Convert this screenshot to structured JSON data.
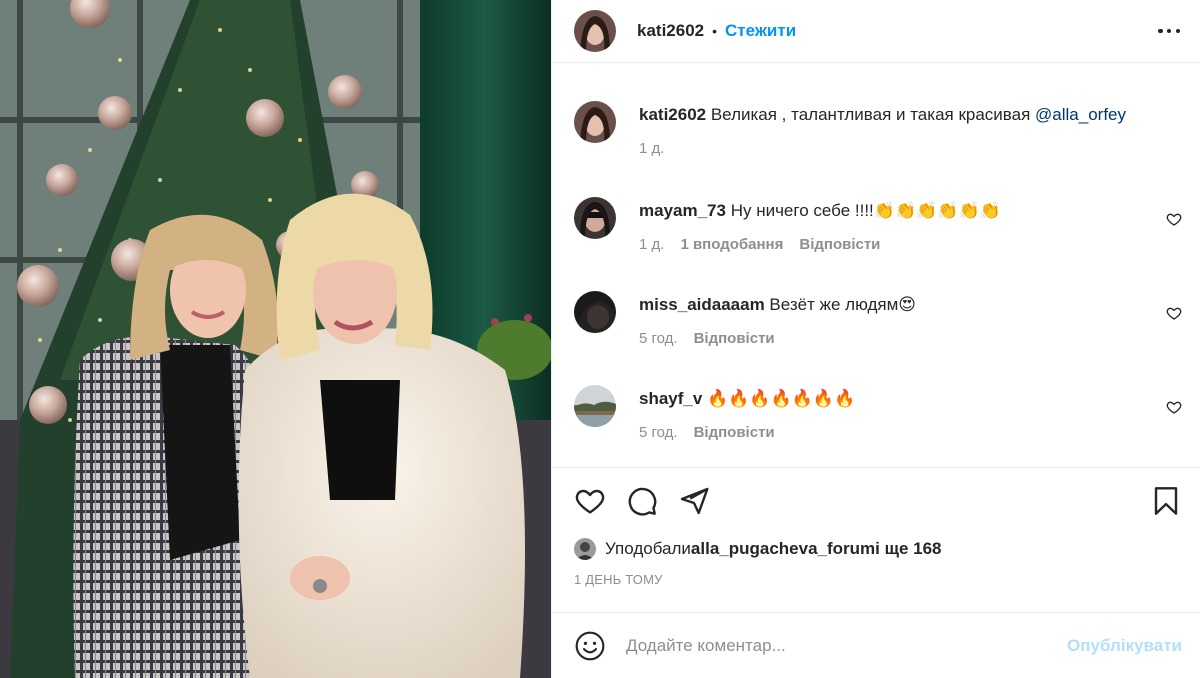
{
  "post": {
    "author": "kati2602",
    "follow_label": "Стежити",
    "separator": "•"
  },
  "caption": {
    "author": "kati2602",
    "text": " Великая , талантливая и такая красивая ",
    "mention": "@alla_orfey",
    "time": "1 д."
  },
  "comments": [
    {
      "author": "mayam_73",
      "text": " Ну ничего себе !!!!👏👏👏👏👏👏",
      "time": "1 д.",
      "likes": "1 вподобання",
      "reply": "Відповісти"
    },
    {
      "author": "miss_aidaaaam",
      "text": " Везёт же людям😍",
      "time": "5 год.",
      "reply": "Відповісти"
    },
    {
      "author": "shayf_v",
      "text": " 🔥🔥🔥🔥🔥🔥🔥",
      "time": "5 год.",
      "reply": "Відповісти"
    }
  ],
  "likes": {
    "prefix": "Уподобали ",
    "user": "alla_pugacheva_forum",
    "suffix": " і ще 168"
  },
  "timestamp": "1 ДЕНЬ ТОМУ",
  "add_comment": {
    "placeholder": "Додайте коментар...",
    "publish_label": "Опублікувати"
  },
  "colors": {
    "accent": "#0095f6",
    "publish_disabled": "#b2dffc",
    "secondary_text": "#8e8e8e",
    "mention": "#00376b"
  }
}
